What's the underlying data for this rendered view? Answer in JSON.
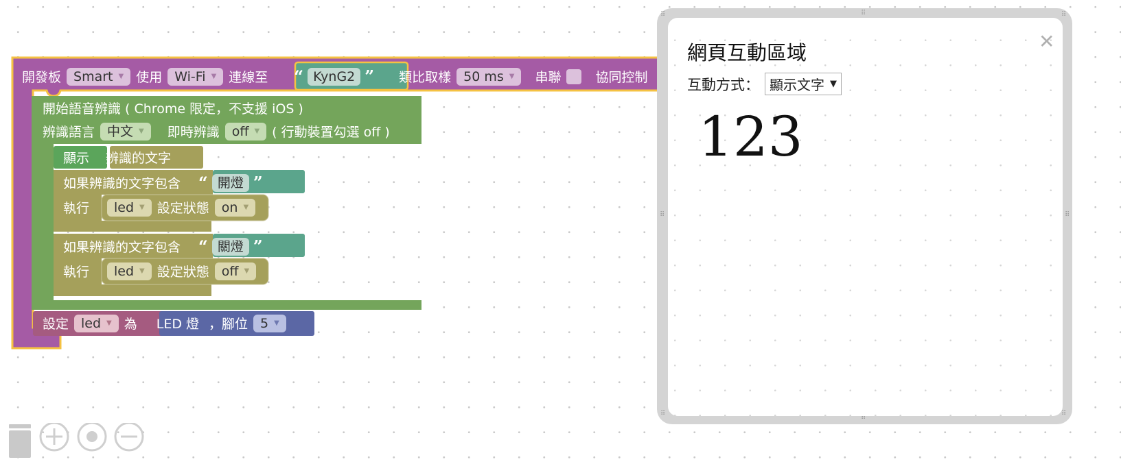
{
  "workspace": {
    "board_block": {
      "label_board": "開發板",
      "board_value": "Smart",
      "label_use": "使用",
      "conn_value": "Wi-Fi",
      "label_connect": "連線至",
      "device_id": "KynG2",
      "label_sampling": "類比取樣",
      "sampling_value": "50 ms",
      "label_serial": "串聯",
      "label_coop": "協同控制"
    },
    "speech_block": {
      "title": "開始語音辨識 ( Chrome 限定，不支援 iOS )",
      "label_lang": "辨識語言",
      "lang_value": "中文",
      "label_instant": "即時辨識",
      "instant_value": "off",
      "instant_note": "( 行動裝置勾選 off )"
    },
    "show_block": {
      "label": "顯示",
      "value": "辨識的文字"
    },
    "if_blocks": [
      {
        "label_if": "如果辨識的文字包含",
        "text": "開燈",
        "label_do": "執行",
        "device": "led",
        "label_set": "設定狀態",
        "state": "on"
      },
      {
        "label_if": "如果辨識的文字包含",
        "text": "關燈",
        "label_do": "執行",
        "device": "led",
        "label_set": "設定狀態",
        "state": "off"
      }
    ],
    "set_block": {
      "label_set": "設定",
      "var": "led",
      "label_as": "為",
      "led_label": "LED 燈",
      "pin_label": "，腳位",
      "pin_value": "5"
    },
    "colors": {
      "board": "#a55ba5",
      "board_outline": "#f5c242",
      "speech": "#74a55b",
      "logic": "#a5a05b",
      "show": "#5ba55b",
      "text": "#5ba58c",
      "variable": "#a55b80",
      "led": "#5b67a5"
    }
  },
  "toolbar_icons": [
    "trash-icon",
    "zoom-in-icon",
    "reset-zoom-icon",
    "zoom-out-icon"
  ],
  "panel": {
    "title": "網頁互動區域",
    "mode_label": "互動方式：",
    "mode_value": "顯示文字",
    "display_text": "123",
    "close_symbol": "✕"
  }
}
